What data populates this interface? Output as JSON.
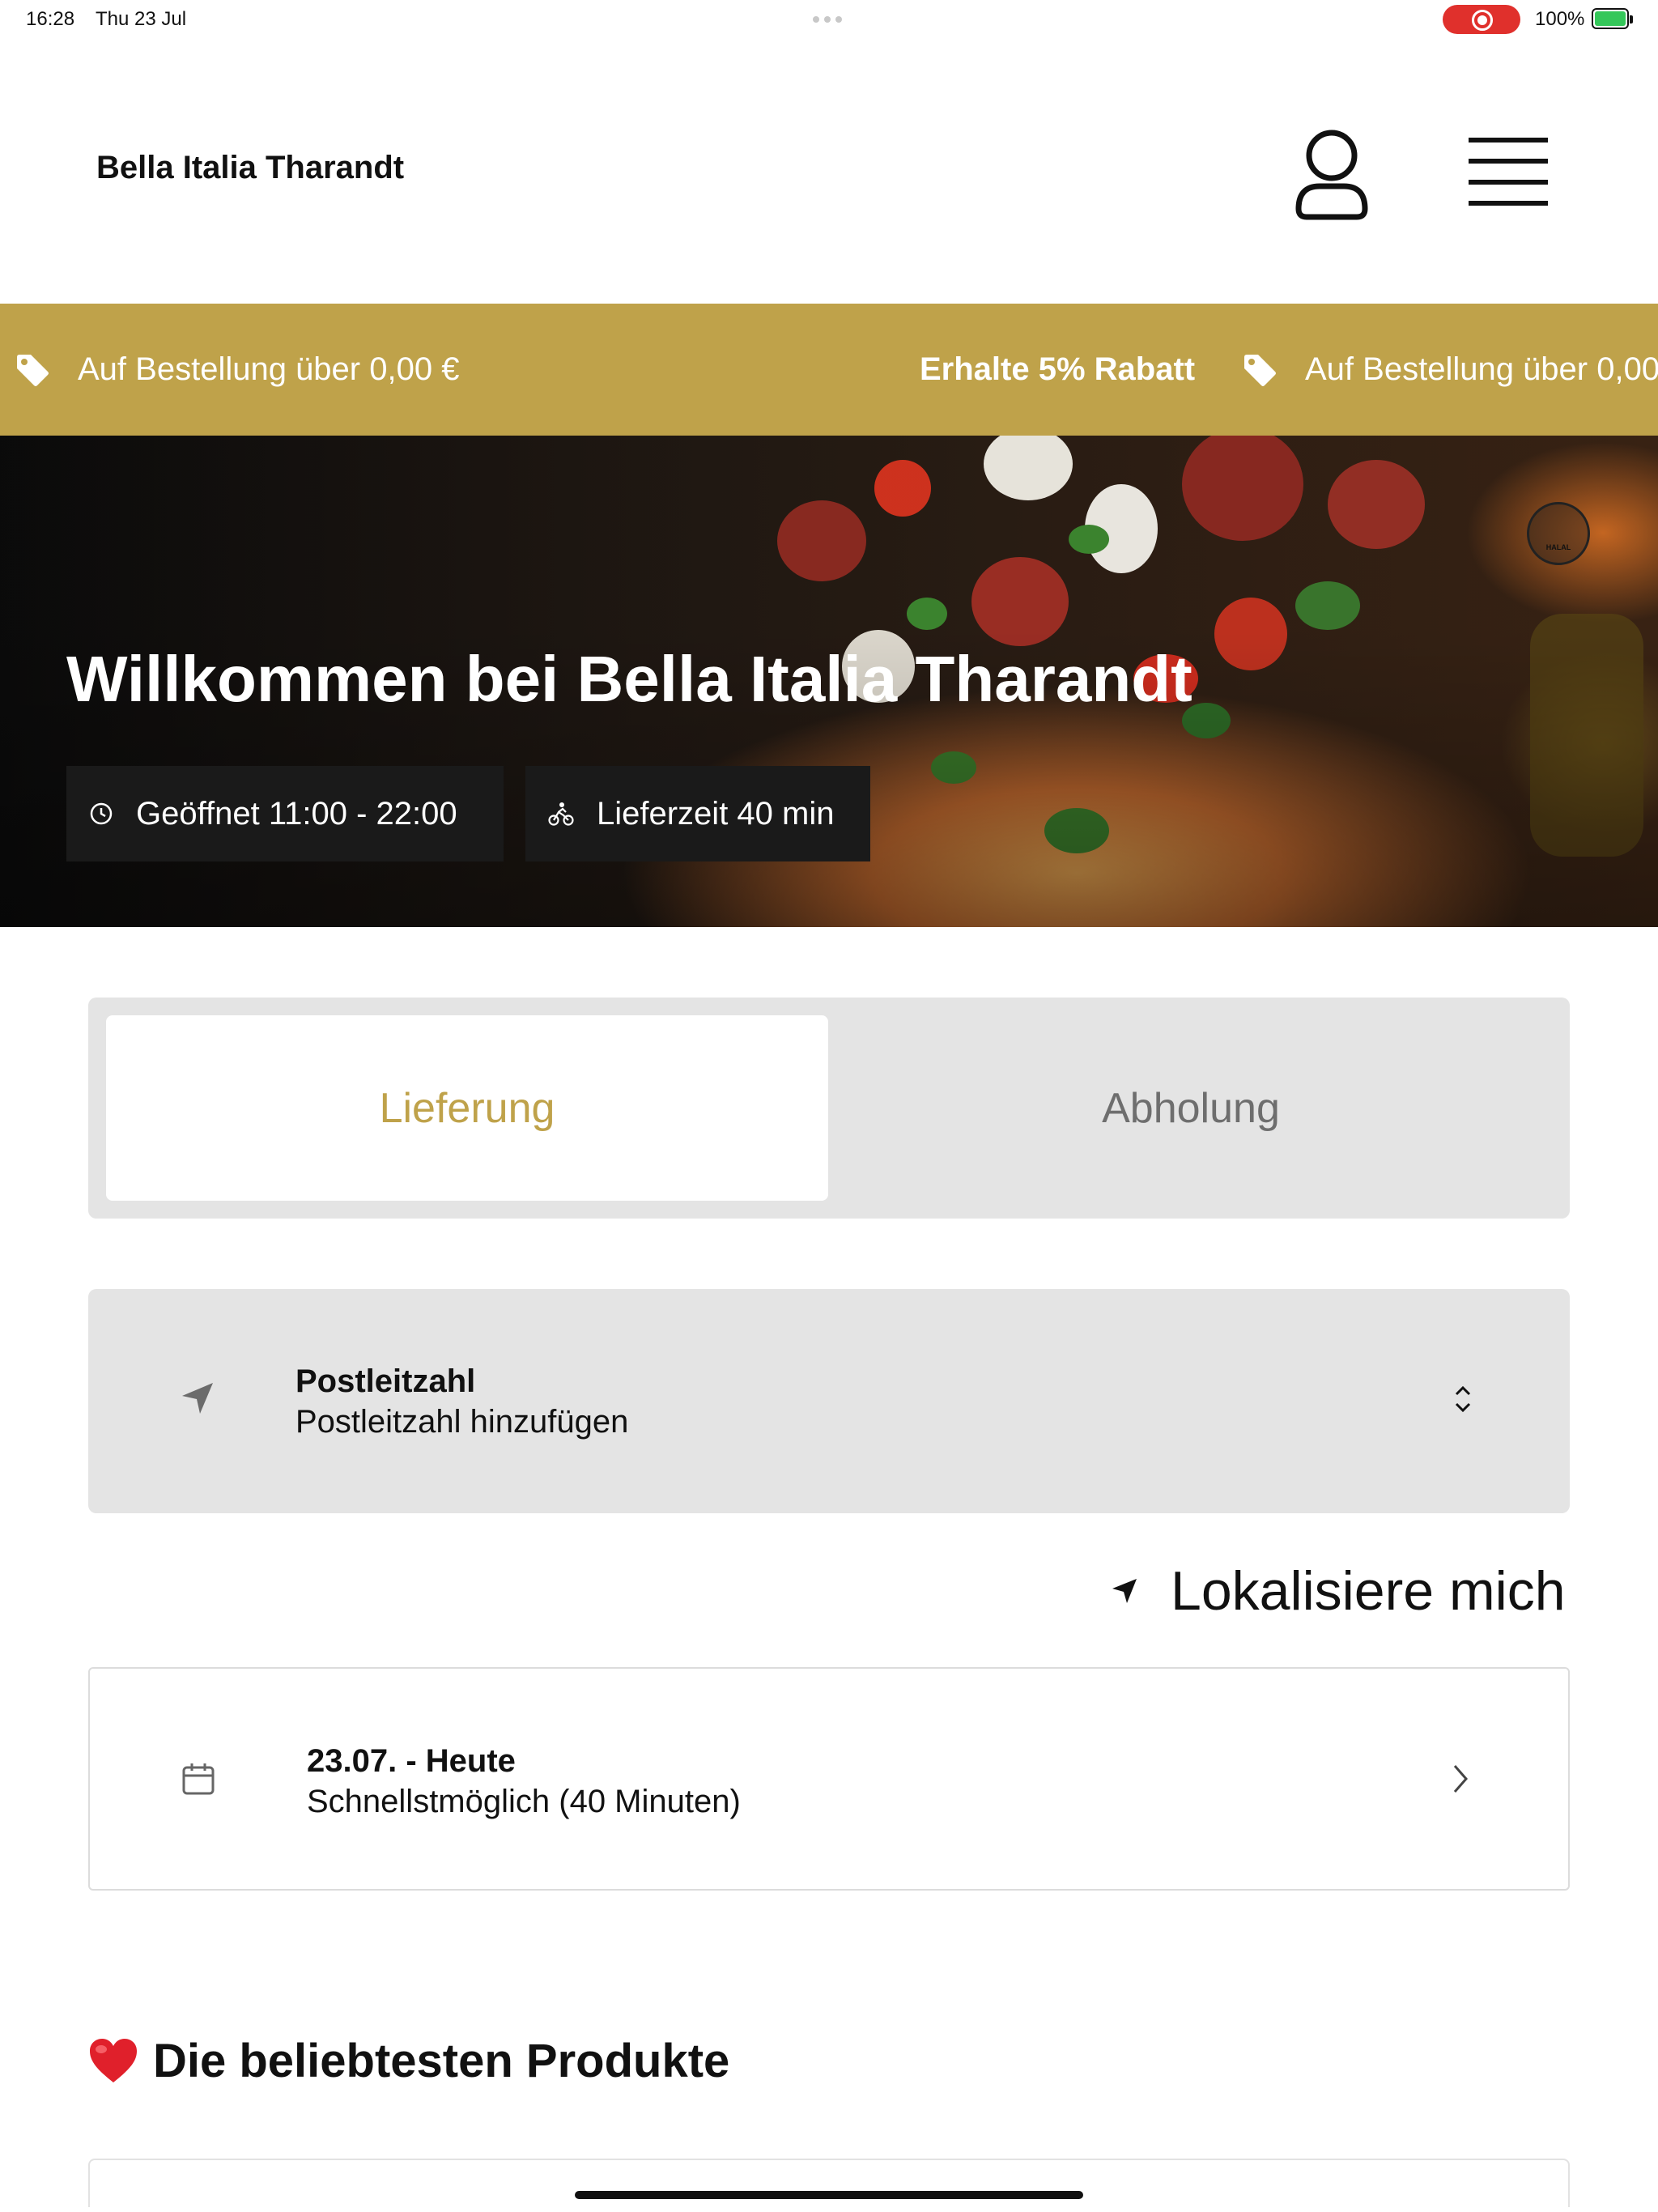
{
  "status_bar": {
    "time": "16:28",
    "date": "Thu 23 Jul",
    "battery": "100%",
    "recording_color": "#e0302c",
    "battery_color": "#34c759"
  },
  "header": {
    "brand": "Bella Italia Tharandt",
    "icons": [
      "user-icon",
      "hamburger-menu-icon"
    ]
  },
  "promo": {
    "color": "#bfa24a",
    "items": [
      {
        "icon": "tag-icon",
        "text": "Auf Bestellung über 0,00 €"
      },
      {
        "text": "Erhalte 5% Rabatt"
      },
      {
        "icon": "tag-icon",
        "text": "Auf Bestellung über 0,00 €"
      }
    ]
  },
  "hero": {
    "title": "Willkommen bei Bella Italia Tharandt",
    "opening_hours": "Geöffnet 11:00 - 22:00",
    "delivery_time": "Lieferzeit 40 min",
    "badge": "HALAL"
  },
  "tabs": {
    "delivery": "Lieferung",
    "pickup": "Abholung",
    "active": "Lieferung",
    "active_color": "#bfa24a"
  },
  "postcode": {
    "label": "Postleitzahl",
    "placeholder": "Postleitzahl hinzufügen"
  },
  "locate": {
    "label": "Lokalisiere mich"
  },
  "schedule": {
    "date": "23.07. - Heute",
    "time": "Schnellstmöglich (40 Minuten)"
  },
  "popular": {
    "emoji": "❤️",
    "title": "Die beliebtesten Produkte"
  }
}
